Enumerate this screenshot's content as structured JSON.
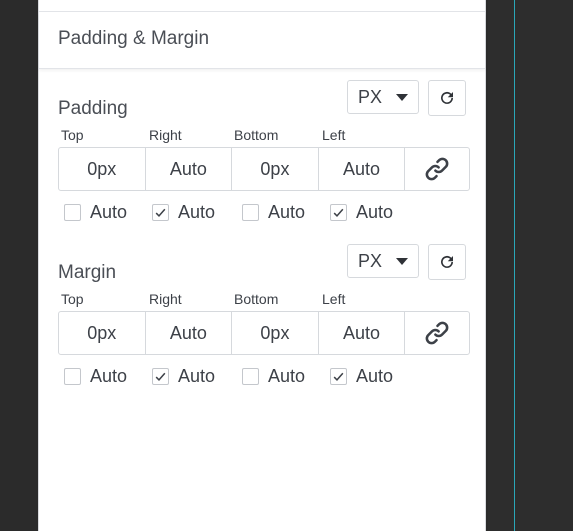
{
  "section": {
    "title": "Padding & Margin"
  },
  "padding": {
    "label": "Padding",
    "unit": "PX",
    "fields": [
      {
        "label": "Top",
        "value": "0px"
      },
      {
        "label": "Right",
        "value": "Auto"
      },
      {
        "label": "Bottom",
        "value": "0px"
      },
      {
        "label": "Left",
        "value": "Auto"
      }
    ],
    "auto": [
      {
        "label": "Auto",
        "checked": false
      },
      {
        "label": "Auto",
        "checked": true
      },
      {
        "label": "Auto",
        "checked": false
      },
      {
        "label": "Auto",
        "checked": true
      }
    ]
  },
  "margin": {
    "label": "Margin",
    "unit": "PX",
    "fields": [
      {
        "label": "Top",
        "value": "0px"
      },
      {
        "label": "Right",
        "value": "Auto"
      },
      {
        "label": "Bottom",
        "value": "0px"
      },
      {
        "label": "Left",
        "value": "Auto"
      }
    ],
    "auto": [
      {
        "label": "Auto",
        "checked": false
      },
      {
        "label": "Auto",
        "checked": true
      },
      {
        "label": "Auto",
        "checked": false
      },
      {
        "label": "Auto",
        "checked": true
      }
    ]
  },
  "icons": {
    "reset": "reset-icon",
    "link": "link-icon",
    "caret": "chevron-down-icon"
  },
  "colors": {
    "guide": "#2aa7b8",
    "background": "#2b2b2b",
    "panel": "#ffffff"
  }
}
